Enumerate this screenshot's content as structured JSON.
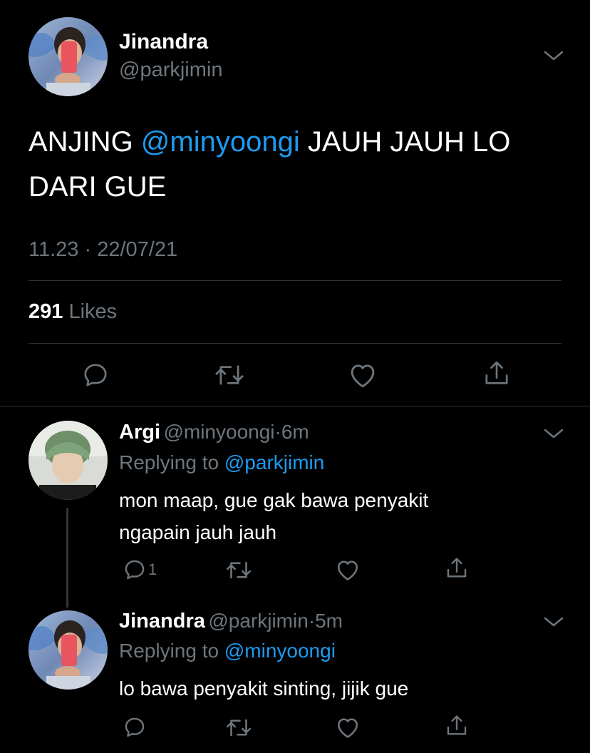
{
  "main_tweet": {
    "display_name": "Jinandra",
    "handle": "@parkjimin",
    "text_pre": "ANJING ",
    "mention": "@minyoongi",
    "text_post": " JAUH JAUH LO DARI GUE",
    "time": "11.23",
    "separator": "·",
    "date": "22/07/21",
    "likes_count": "291",
    "likes_label": "Likes"
  },
  "replies": [
    {
      "display_name": "Argi",
      "handle": "@minyoongi",
      "separator": "·",
      "age": "6m",
      "replying_label": "Replying to ",
      "replying_to": "@parkjimin",
      "text": "mon maap, gue gak bawa penyakit ngapain jauh jauh",
      "reply_count": "1"
    },
    {
      "display_name": "Jinandra",
      "handle": "@parkjimin",
      "separator": "·",
      "age": "5m",
      "replying_label": "Replying to ",
      "replying_to": "@minyoongi",
      "text": "lo bawa penyakit sinting, jijik gue",
      "reply_count": ""
    }
  ],
  "icons": {
    "reply": "reply-icon",
    "retweet": "retweet-icon",
    "like": "heart-icon",
    "share": "share-icon",
    "more": "chevron-down-icon"
  },
  "colors": {
    "background": "#000000",
    "text": "#ffffff",
    "secondary": "#6e767d",
    "link": "#1d9bf0",
    "divider": "#2f3336"
  }
}
